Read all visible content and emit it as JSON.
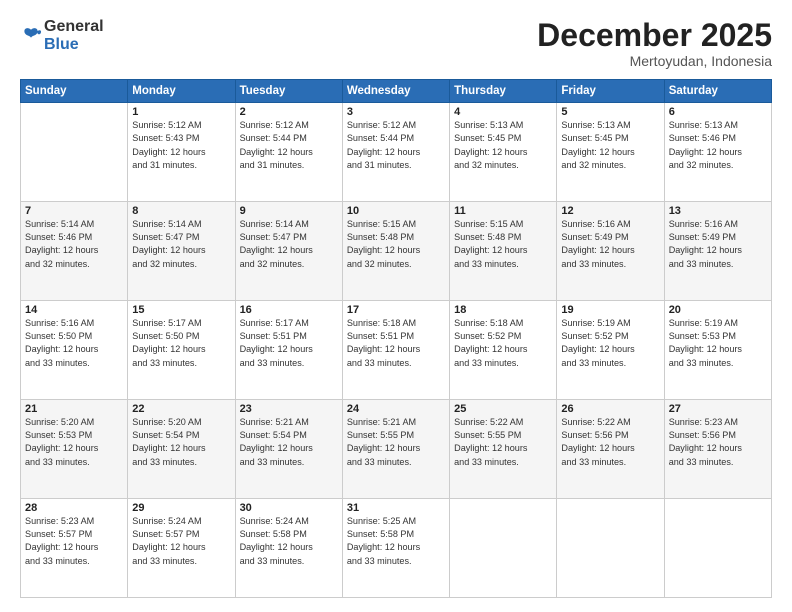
{
  "header": {
    "logo_general": "General",
    "logo_blue": "Blue",
    "month": "December 2025",
    "location": "Mertoyudan, Indonesia"
  },
  "days_of_week": [
    "Sunday",
    "Monday",
    "Tuesday",
    "Wednesday",
    "Thursday",
    "Friday",
    "Saturday"
  ],
  "weeks": [
    [
      {
        "day": "",
        "info": ""
      },
      {
        "day": "1",
        "info": "Sunrise: 5:12 AM\nSunset: 5:43 PM\nDaylight: 12 hours\nand 31 minutes."
      },
      {
        "day": "2",
        "info": "Sunrise: 5:12 AM\nSunset: 5:44 PM\nDaylight: 12 hours\nand 31 minutes."
      },
      {
        "day": "3",
        "info": "Sunrise: 5:12 AM\nSunset: 5:44 PM\nDaylight: 12 hours\nand 31 minutes."
      },
      {
        "day": "4",
        "info": "Sunrise: 5:13 AM\nSunset: 5:45 PM\nDaylight: 12 hours\nand 32 minutes."
      },
      {
        "day": "5",
        "info": "Sunrise: 5:13 AM\nSunset: 5:45 PM\nDaylight: 12 hours\nand 32 minutes."
      },
      {
        "day": "6",
        "info": "Sunrise: 5:13 AM\nSunset: 5:46 PM\nDaylight: 12 hours\nand 32 minutes."
      }
    ],
    [
      {
        "day": "7",
        "info": "Sunrise: 5:14 AM\nSunset: 5:46 PM\nDaylight: 12 hours\nand 32 minutes."
      },
      {
        "day": "8",
        "info": "Sunrise: 5:14 AM\nSunset: 5:47 PM\nDaylight: 12 hours\nand 32 minutes."
      },
      {
        "day": "9",
        "info": "Sunrise: 5:14 AM\nSunset: 5:47 PM\nDaylight: 12 hours\nand 32 minutes."
      },
      {
        "day": "10",
        "info": "Sunrise: 5:15 AM\nSunset: 5:48 PM\nDaylight: 12 hours\nand 32 minutes."
      },
      {
        "day": "11",
        "info": "Sunrise: 5:15 AM\nSunset: 5:48 PM\nDaylight: 12 hours\nand 33 minutes."
      },
      {
        "day": "12",
        "info": "Sunrise: 5:16 AM\nSunset: 5:49 PM\nDaylight: 12 hours\nand 33 minutes."
      },
      {
        "day": "13",
        "info": "Sunrise: 5:16 AM\nSunset: 5:49 PM\nDaylight: 12 hours\nand 33 minutes."
      }
    ],
    [
      {
        "day": "14",
        "info": "Sunrise: 5:16 AM\nSunset: 5:50 PM\nDaylight: 12 hours\nand 33 minutes."
      },
      {
        "day": "15",
        "info": "Sunrise: 5:17 AM\nSunset: 5:50 PM\nDaylight: 12 hours\nand 33 minutes."
      },
      {
        "day": "16",
        "info": "Sunrise: 5:17 AM\nSunset: 5:51 PM\nDaylight: 12 hours\nand 33 minutes."
      },
      {
        "day": "17",
        "info": "Sunrise: 5:18 AM\nSunset: 5:51 PM\nDaylight: 12 hours\nand 33 minutes."
      },
      {
        "day": "18",
        "info": "Sunrise: 5:18 AM\nSunset: 5:52 PM\nDaylight: 12 hours\nand 33 minutes."
      },
      {
        "day": "19",
        "info": "Sunrise: 5:19 AM\nSunset: 5:52 PM\nDaylight: 12 hours\nand 33 minutes."
      },
      {
        "day": "20",
        "info": "Sunrise: 5:19 AM\nSunset: 5:53 PM\nDaylight: 12 hours\nand 33 minutes."
      }
    ],
    [
      {
        "day": "21",
        "info": "Sunrise: 5:20 AM\nSunset: 5:53 PM\nDaylight: 12 hours\nand 33 minutes."
      },
      {
        "day": "22",
        "info": "Sunrise: 5:20 AM\nSunset: 5:54 PM\nDaylight: 12 hours\nand 33 minutes."
      },
      {
        "day": "23",
        "info": "Sunrise: 5:21 AM\nSunset: 5:54 PM\nDaylight: 12 hours\nand 33 minutes."
      },
      {
        "day": "24",
        "info": "Sunrise: 5:21 AM\nSunset: 5:55 PM\nDaylight: 12 hours\nand 33 minutes."
      },
      {
        "day": "25",
        "info": "Sunrise: 5:22 AM\nSunset: 5:55 PM\nDaylight: 12 hours\nand 33 minutes."
      },
      {
        "day": "26",
        "info": "Sunrise: 5:22 AM\nSunset: 5:56 PM\nDaylight: 12 hours\nand 33 minutes."
      },
      {
        "day": "27",
        "info": "Sunrise: 5:23 AM\nSunset: 5:56 PM\nDaylight: 12 hours\nand 33 minutes."
      }
    ],
    [
      {
        "day": "28",
        "info": "Sunrise: 5:23 AM\nSunset: 5:57 PM\nDaylight: 12 hours\nand 33 minutes."
      },
      {
        "day": "29",
        "info": "Sunrise: 5:24 AM\nSunset: 5:57 PM\nDaylight: 12 hours\nand 33 minutes."
      },
      {
        "day": "30",
        "info": "Sunrise: 5:24 AM\nSunset: 5:58 PM\nDaylight: 12 hours\nand 33 minutes."
      },
      {
        "day": "31",
        "info": "Sunrise: 5:25 AM\nSunset: 5:58 PM\nDaylight: 12 hours\nand 33 minutes."
      },
      {
        "day": "",
        "info": ""
      },
      {
        "day": "",
        "info": ""
      },
      {
        "day": "",
        "info": ""
      }
    ]
  ]
}
